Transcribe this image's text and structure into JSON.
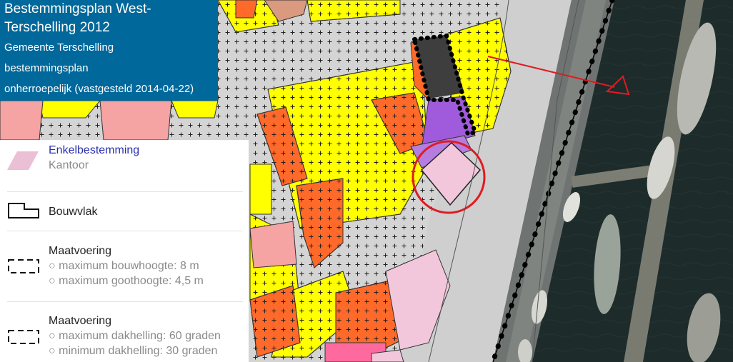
{
  "title": {
    "line1": "Bestemmingsplan West-",
    "line2": "Terschelling 2012",
    "municipality": "Gemeente Terschelling",
    "plan_type": "bestemmingsplan",
    "status": "onherroepelijk (vastgesteld 2014-04-22)"
  },
  "legend": {
    "item1": {
      "heading": "Enkelbestemming",
      "value": "Kantoor",
      "color": "#ebbfd5"
    },
    "item2": {
      "label": "Bouwvlak"
    },
    "item3": {
      "heading": "Maatvoering",
      "bullets": [
        "maximum bouwhoogte: 8 m",
        "maximum goothoogte: 4,5 m"
      ]
    },
    "item4": {
      "heading": "Maatvoering",
      "bullets": [
        "maximum dakhelling: 60 graden",
        "minimum dakhelling: 30 graden"
      ]
    }
  },
  "colors": {
    "woongebied": "#ffff00",
    "centrum": "#ff6a2a",
    "kantoor": "#f2c7dc",
    "maatschappelijk": "#a05adc",
    "horeca": "#f6a3a3",
    "water": "#1c2a2a",
    "highlight": "#e01b22"
  }
}
